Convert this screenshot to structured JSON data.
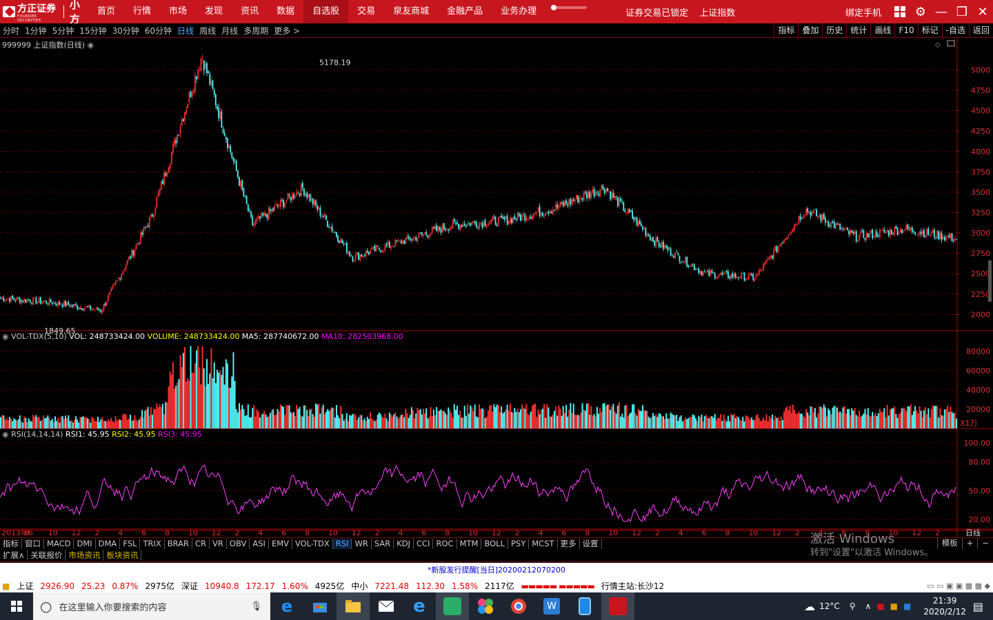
{
  "topbar": {
    "brand": "方正证券",
    "brand_sub": "FOUNDER SECURITIES",
    "product": "小方",
    "nav": [
      "首页",
      "行情",
      "市场",
      "发现",
      "资讯",
      "数据",
      "自选股",
      "交易",
      "泉友商城",
      "金融产品",
      "业务办理"
    ],
    "active_nav": "自选股",
    "status": "证券交易已锁定",
    "index_name": "上证指数",
    "bind_phone": "绑定手机"
  },
  "periods": [
    "分时",
    "1分钟",
    "5分钟",
    "15分钟",
    "30分钟",
    "60分钟",
    "日线",
    "周线",
    "月线",
    "多周期",
    "更多 >"
  ],
  "active_period": "日线",
  "tools": [
    "指标",
    "叠加",
    "历史",
    "统计",
    "画线",
    "F10",
    "标记",
    "-自选",
    "返回"
  ],
  "main_panel": {
    "title": "999999 上证指数(日线)",
    "high_label": "5178.19",
    "low_label": "1849.65",
    "y_ticks": [
      "5000",
      "4750",
      "4500",
      "4250",
      "4000",
      "3750",
      "3500",
      "3250",
      "3000",
      "2750",
      "2500",
      "2250",
      "2000"
    ]
  },
  "vol_panel": {
    "name": "VOL-TDX(5,10)",
    "vol": "VOL: 248733424.00",
    "volume": "VOLUME: 248733424.00",
    "ma5": "MA5: 287740672.00",
    "ma10": "MA10: 282503968.00",
    "y_ticks": [
      "80000",
      "60000",
      "40000",
      "20000"
    ],
    "unit": "X1万"
  },
  "rsi_panel": {
    "name": "RSI(14,14,14)",
    "rsi1": "RSI1: 45.95",
    "rsi2": "RSI2: 45.95",
    "rsi3": "RSI3: 45.95",
    "y_ticks": [
      "100.00",
      "80.00",
      "50.00",
      "20.00"
    ]
  },
  "time_axis": {
    "labels": [
      "2013年6",
      "8",
      "10",
      "12",
      "2",
      "4",
      "6",
      "8",
      "10",
      "12",
      "2",
      "4",
      "6",
      "8",
      "10",
      "12",
      "2",
      "4",
      "6",
      "8",
      "10",
      "12",
      "2",
      "4",
      "6",
      "8",
      "10",
      "12",
      "2",
      "4",
      "6",
      "8",
      "10",
      "12",
      "2",
      "4",
      "6",
      "8",
      "10",
      "12",
      "2"
    ],
    "period_label": "日线"
  },
  "indicator_tabs": [
    "指标",
    "窗口",
    "MACD",
    "DMI",
    "DMA",
    "FSL",
    "TRIX",
    "BRAR",
    "CR",
    "VR",
    "OBV",
    "ASI",
    "EMV",
    "VOL-TDX",
    "RSI",
    "WR",
    "SAR",
    "KDJ",
    "CCI",
    "ROC",
    "MTM",
    "BOLL",
    "PSY",
    "MCST",
    "更多",
    "设置"
  ],
  "active_indicator": "RSI",
  "indicator_right": [
    "模板",
    "+",
    "−"
  ],
  "ext_tabs": [
    "扩展∧",
    "关联报价",
    "市场资讯",
    "板块资讯"
  ],
  "win_activate": {
    "line1": "激活 Windows",
    "line2": "转到\"设置\"以激活 Windows。"
  },
  "notice": "*新股发行提醒[当日]20200212070200",
  "status": {
    "sh_name": "上证",
    "sh_val": "2926.90",
    "sh_chg": "25.23",
    "sh_pct": "0.87%",
    "sh_amt": "2975亿",
    "sz_name": "深证",
    "sz_val": "10940.8",
    "sz_chg": "172.17",
    "sz_pct": "1.60%",
    "sz_amt": "4925亿",
    "zx_name": "中小",
    "zx_val": "7221.48",
    "zx_chg": "112.30",
    "zx_pct": "1.58%",
    "zx_amt": "2117亿",
    "server": "行情主站:长沙12"
  },
  "taskbar": {
    "search_placeholder": "在这里输入你要搜索的内容",
    "weather": "12°C",
    "time": "21:39",
    "date": "2020/2/12"
  },
  "chart_data": {
    "type": "candlestick",
    "title": "999999 上证指数(日线)",
    "x": [
      "2013-06",
      "2013-12",
      "2014-06",
      "2014-12",
      "2015-06",
      "2015-09",
      "2015-12",
      "2016-01",
      "2016-06",
      "2016-12",
      "2017-06",
      "2017-12",
      "2018-01",
      "2018-06",
      "2018-12",
      "2019-01",
      "2019-04",
      "2019-06",
      "2019-12",
      "2020-02"
    ],
    "close": [
      2200,
      2150,
      2050,
      3200,
      5178,
      3100,
      3550,
      2700,
      2900,
      3100,
      3150,
      3300,
      3560,
      2900,
      2500,
      2450,
      3290,
      2950,
      3050,
      2927
    ],
    "ylim": [
      1800,
      5300
    ],
    "high": 5178.19,
    "low": 1849.65,
    "volume_ylim": [
      0,
      90000
    ],
    "rsi_ylim": [
      10,
      105
    ]
  }
}
